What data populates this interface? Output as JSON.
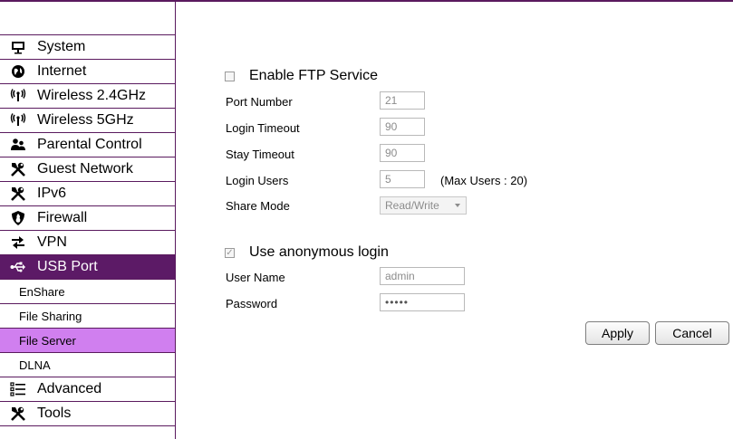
{
  "sidebar": {
    "items": [
      {
        "label": "System",
        "icon": "monitor-icon"
      },
      {
        "label": "Internet",
        "icon": "globe-icon"
      },
      {
        "label": "Wireless 2.4GHz",
        "icon": "wireless-icon"
      },
      {
        "label": "Wireless 5GHz",
        "icon": "wireless-icon"
      },
      {
        "label": "Parental Control",
        "icon": "people-icon"
      },
      {
        "label": "Guest Network",
        "icon": "tools-icon"
      },
      {
        "label": "IPv6",
        "icon": "tools-icon"
      },
      {
        "label": "Firewall",
        "icon": "shield-icon"
      },
      {
        "label": "VPN",
        "icon": "arrows-icon"
      },
      {
        "label": "USB Port",
        "icon": "usb-icon"
      }
    ],
    "sub_items": [
      "EnShare",
      "File Sharing",
      "File Server",
      "DLNA"
    ],
    "bottom_items": [
      {
        "label": "Advanced",
        "icon": "list-icon"
      },
      {
        "label": "Tools",
        "icon": "tools-icon"
      }
    ],
    "accent_color": "#5c1a66",
    "sub_active_color": "#d07fef"
  },
  "ftp": {
    "enable_label": "Enable FTP Service",
    "enabled": false,
    "port_label": "Port Number",
    "port_value": "21",
    "login_timeout_label": "Login Timeout",
    "login_timeout_value": "90",
    "stay_timeout_label": "Stay Timeout",
    "stay_timeout_value": "90",
    "login_users_label": "Login Users",
    "login_users_value": "5",
    "max_users_note": "(Max Users : 20)",
    "share_mode_label": "Share Mode",
    "share_mode_value": "Read/Write"
  },
  "anonymous": {
    "label": "Use anonymous login",
    "checked": true,
    "username_label": "User Name",
    "username_value": "admin",
    "password_label": "Password",
    "password_value": "•••••"
  },
  "actions": {
    "apply": "Apply",
    "cancel": "Cancel"
  }
}
